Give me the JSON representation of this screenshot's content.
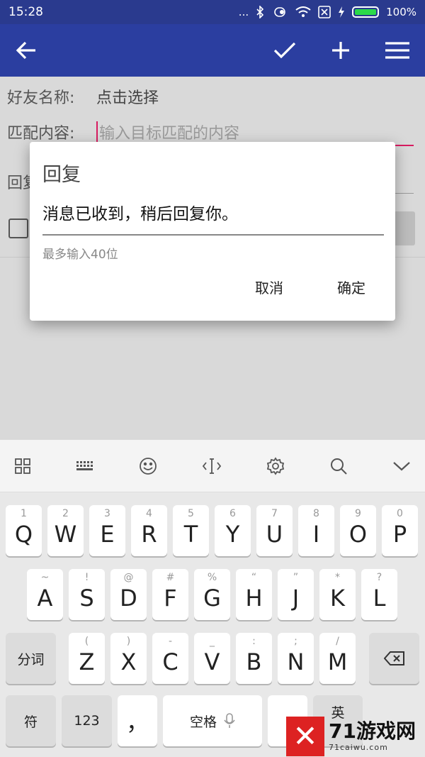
{
  "status": {
    "time": "15:28",
    "dots": "...",
    "battery_text": "100%",
    "battery_level": 1.0
  },
  "app_bar": {
    "back_icon": "arrow-left-icon",
    "confirm_icon": "checkmark-icon",
    "add_icon": "plus-icon",
    "menu_icon": "hamburger-menu-icon"
  },
  "form": {
    "friend_label": "好友名称:",
    "friend_value": "点击选择",
    "match_label": "匹配内容:",
    "match_placeholder": "输入目标匹配的内容",
    "reply_label": "回复"
  },
  "dialog": {
    "title": "回复",
    "input_value": "消息已收到，稍后回复你。",
    "hint": "最多输入40位",
    "cancel": "取消",
    "ok": "确定"
  },
  "keyboard": {
    "toolbar_icons": [
      "grid-icon",
      "keyboard-icon",
      "emoji-icon",
      "cursor-icon",
      "settings-gear-icon",
      "search-icon",
      "collapse-chevron-icon"
    ],
    "row1": [
      {
        "k": "Q",
        "h": "1"
      },
      {
        "k": "W",
        "h": "2"
      },
      {
        "k": "E",
        "h": "3"
      },
      {
        "k": "R",
        "h": "4"
      },
      {
        "k": "T",
        "h": "5"
      },
      {
        "k": "Y",
        "h": "6"
      },
      {
        "k": "U",
        "h": "7"
      },
      {
        "k": "I",
        "h": "8"
      },
      {
        "k": "O",
        "h": "9"
      },
      {
        "k": "P",
        "h": "0"
      }
    ],
    "row2": [
      {
        "k": "A",
        "h": "~"
      },
      {
        "k": "S",
        "h": "!"
      },
      {
        "k": "D",
        "h": "@"
      },
      {
        "k": "F",
        "h": "#"
      },
      {
        "k": "G",
        "h": "%"
      },
      {
        "k": "H",
        "h": "“"
      },
      {
        "k": "J",
        "h": "”"
      },
      {
        "k": "K",
        "h": "*"
      },
      {
        "k": "L",
        "h": "?"
      }
    ],
    "row3": [
      {
        "k": "Z",
        "h": "("
      },
      {
        "k": "X",
        "h": ")"
      },
      {
        "k": "C",
        "h": "-"
      },
      {
        "k": "V",
        "h": "_"
      },
      {
        "k": "B",
        "h": ":"
      },
      {
        "k": "N",
        "h": ";"
      },
      {
        "k": "M",
        "h": "/"
      }
    ],
    "fenci": "分词",
    "fu": "符",
    "num": "123",
    "comma": "，",
    "space": "空格",
    "lang": "英"
  },
  "watermark": {
    "mark": "✕",
    "big": "71游戏网",
    "small": "71caiwu.com"
  }
}
